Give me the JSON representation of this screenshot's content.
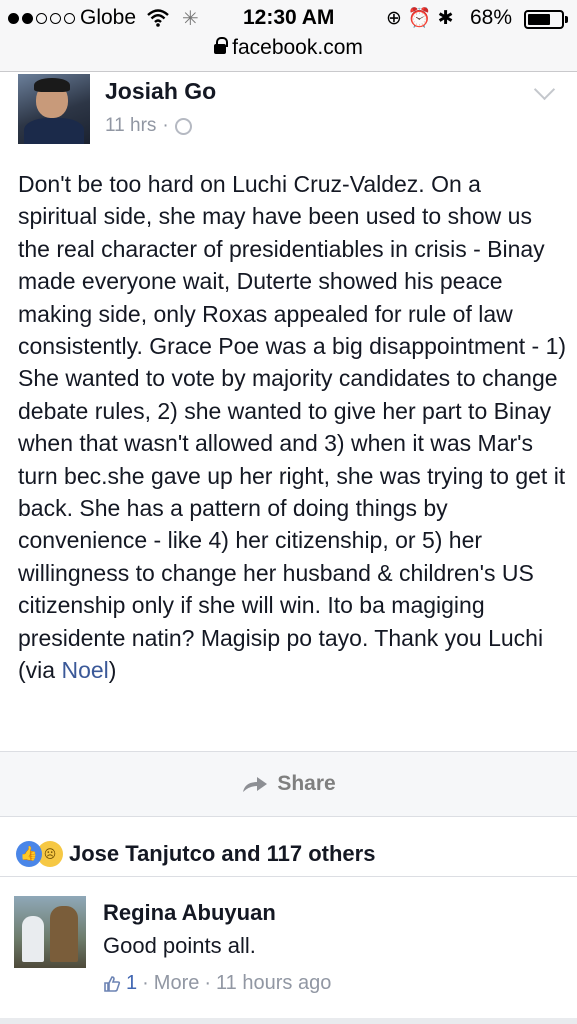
{
  "status_bar": {
    "carrier": "Globe",
    "time": "12:30 AM",
    "battery": "68%",
    "battery_level": 0.68
  },
  "browser": {
    "url": "facebook.com"
  },
  "post": {
    "author": "Josiah Go",
    "time": "11 hrs",
    "separator": "·",
    "body": "Don't be too hard on Luchi Cruz-Valdez. On a spiritual side, she may have been used to show us the real character of presidentiables in crisis - Binay made everyone wait, Duterte showed his peace making side, only Roxas appealed for rule of law consistently. Grace Poe was a big disappointment - 1) She wanted to vote by majority candidates to change debate rules, 2) she wanted to give her part to Binay when that wasn't allowed and 3) when it was Mar's turn bec.she gave up her right, she was trying to get it back. She has a pattern of doing things by convenience - like 4) her citizenship, or 5) her willingness to change her husband & children's US citizenship only if she will win. Ito ba magiging presidente natin? Magisip po tayo. Thank you Luchi (via ",
    "link_text": "Noel",
    "body_end": ")"
  },
  "actions": {
    "share_label": "Share"
  },
  "reactions": {
    "summary": "Jose Tanjutco and 117 others"
  },
  "comment": {
    "author": "Regina Abuyuan",
    "text": "Good points all.",
    "like_count": "1",
    "more_label": "More",
    "time": "11 hours ago",
    "sep1": "·",
    "sep2": "·"
  },
  "icons": {
    "privacy": "globe-icon",
    "options": "chevron-down-icon",
    "share": "share-arrow-icon",
    "like": "like-reaction-icon",
    "sad": "sad-reaction-icon",
    "comment_like": "thumbs-up-icon"
  }
}
